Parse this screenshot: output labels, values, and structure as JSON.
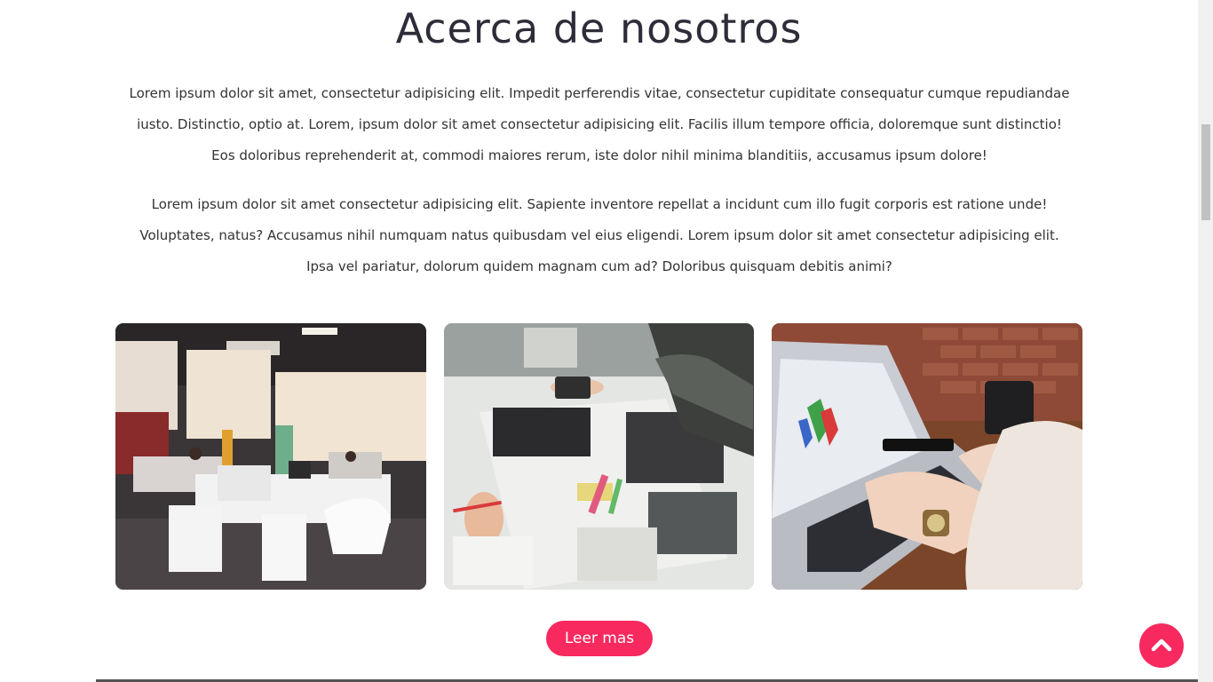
{
  "about": {
    "title": "Acerca de nosotros",
    "paragraph1": "Lorem ipsum dolor sit amet, consectetur adipisicing elit. Impedit perferendis vitae, consectetur cupiditate consequatur cumque repudiandae iusto. Distinctio, optio at. Lorem, ipsum dolor sit amet consectetur adipisicing elit. Facilis illum tempore officia, doloremque sunt distinctio! Eos doloribus reprehenderit at, commodi maiores rerum, iste dolor nihil minima blanditiis, accusamus ipsum dolore!",
    "paragraph2": "Lorem ipsum dolor sit amet consectetur adipisicing elit. Sapiente inventore repellat a incidunt cum illo fugit corporis est ratione unde! Voluptates, natus? Accusamus nihil numquam natus quibusdam vel eius eligendi. Lorem ipsum dolor sit amet consectetur adipisicing elit. Ipsa vel pariatur, dolorum quidem magnam cum ad? Doloribus quisquam debitis animi?",
    "button_label": "Leer mas"
  },
  "gallery": {
    "photos": [
      "office-photo",
      "collage-workspace-photo",
      "laptop-typing-photo"
    ]
  },
  "scroll_top": {
    "icon": "chevron-up-icon"
  },
  "colors": {
    "accent": "#f7295f",
    "heading": "#2d2d3a",
    "text": "#333333"
  }
}
